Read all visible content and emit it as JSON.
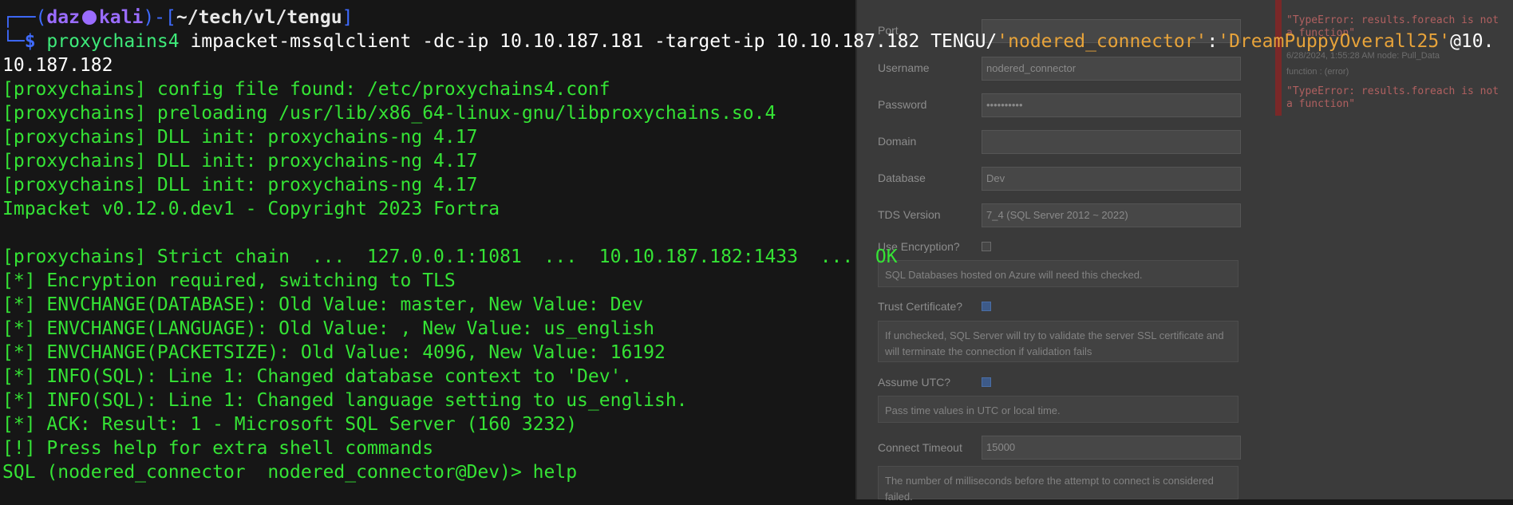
{
  "background_panel": {
    "rows": [
      {
        "label": "Port",
        "value": ""
      },
      {
        "label": "Username",
        "value": "nodered_connector"
      },
      {
        "label": "Password",
        "value": "••••••••••"
      },
      {
        "label": "Domain",
        "value": ""
      },
      {
        "label": "Database",
        "value": "Dev"
      },
      {
        "label": "TDS Version",
        "value": "7_4 (SQL Server 2012 ~ 2022)"
      }
    ],
    "encryption_label": "Use Encryption?",
    "encryption_help": "SQL Databases hosted on Azure will need this checked.",
    "trust_label": "Trust Certificate?",
    "trust_help": "If unchecked, SQL Server will try to validate the server SSL certificate and will terminate the connection if validation fails",
    "utc_label": "Assume UTC?",
    "utc_help": "Pass time values in UTC or local time.",
    "timeout_label": "Connect Timeout",
    "timeout_value": "15000",
    "timeout_help": "The number of milliseconds before the attempt to connect is considered failed."
  },
  "debug_panel": {
    "messages": [
      {
        "text": "\"TypeError: results.foreach is not a function\""
      },
      {
        "meta": "6/28/2024, 1:55:28 AM   node: Pull_Data"
      },
      {
        "meta": "function : (error)"
      },
      {
        "text": "\"TypeError: results.foreach is not a function\""
      }
    ]
  },
  "terminal": {
    "prompt": {
      "corner_top": "┌──(",
      "user": "daz",
      "host": "kali",
      "mid": ")-[",
      "path": "~/tech/vl/tengu",
      "end": "]",
      "corner_bottom": "└─",
      "dollar": "$"
    },
    "command": {
      "tool": "proxychains4",
      "args": " impacket-mssqlclient -dc-ip 10.10.187.181 -target-ip 10.10.187.182 TENGU/",
      "user_str": "'nodered_connector'",
      "colon": ":",
      "pass_str": "'DreamPuppyOverall25'",
      "host_tail": "@10.",
      "wrap": "10.187.182"
    },
    "output_lines": [
      "[proxychains] config file found: /etc/proxychains4.conf",
      "[proxychains] preloading /usr/lib/x86_64-linux-gnu/libproxychains.so.4",
      "[proxychains] DLL init: proxychains-ng 4.17",
      "[proxychains] DLL init: proxychains-ng 4.17",
      "[proxychains] DLL init: proxychains-ng 4.17",
      "Impacket v0.12.0.dev1 - Copyright 2023 Fortra",
      "",
      "[proxychains] Strict chain  ...  127.0.0.1:1081  ...  10.10.187.182:1433  ...  OK",
      "[*] Encryption required, switching to TLS",
      "[*] ENVCHANGE(DATABASE): Old Value: master, New Value: Dev",
      "[*] ENVCHANGE(LANGUAGE): Old Value: , New Value: us_english",
      "[*] ENVCHANGE(PACKETSIZE): Old Value: 4096, New Value: 16192",
      "[*] INFO(SQL): Line 1: Changed database context to 'Dev'.",
      "[*] INFO(SQL): Line 1: Changed language setting to us_english.",
      "[*] ACK: Result: 1 - Microsoft SQL Server (160 3232)",
      "[!] Press help for extra shell commands",
      "SQL (nodered_connector  nodered_connector@Dev)> help"
    ]
  }
}
